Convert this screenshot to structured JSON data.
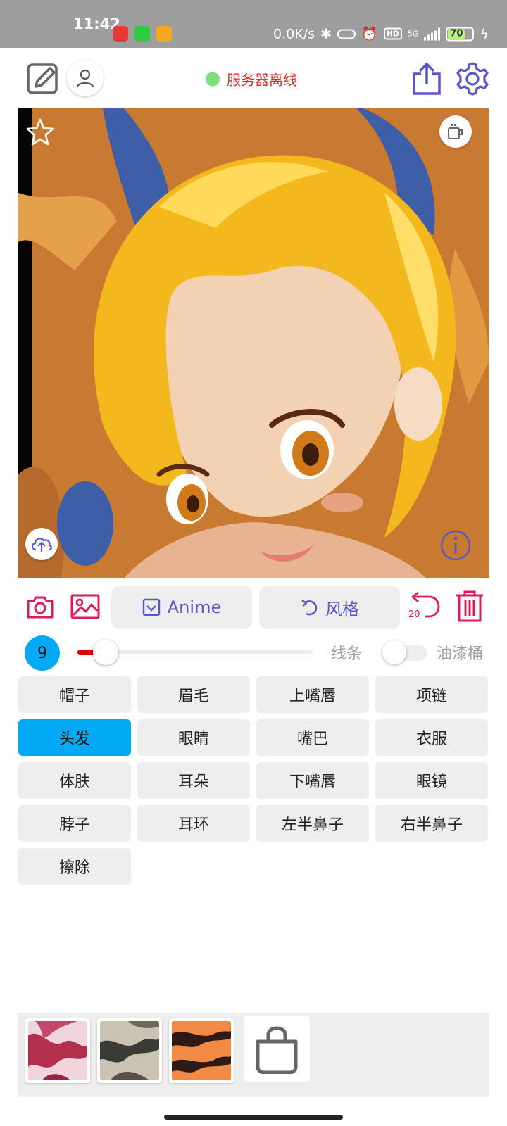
{
  "status_bar": {
    "time": "11:42",
    "net_speed": "0.0K/s",
    "network": "5G",
    "hd": "HD",
    "battery": "70"
  },
  "header": {
    "server_status": "服务器离线",
    "status_color": "#7be07b"
  },
  "toolbar": {
    "anime_label": "Anime",
    "style_label": "风格",
    "undo_count": "20"
  },
  "brush": {
    "size": "9",
    "slider_fraction": 0.12,
    "line_label": "线条",
    "bucket_label": "油漆桶"
  },
  "parts": [
    {
      "label": "帽子"
    },
    {
      "label": "眉毛"
    },
    {
      "label": "上嘴唇"
    },
    {
      "label": "项链"
    },
    {
      "label": "头发"
    },
    {
      "label": "眼睛"
    },
    {
      "label": "嘴巴"
    },
    {
      "label": "衣服"
    },
    {
      "label": "体肤"
    },
    {
      "label": "耳朵"
    },
    {
      "label": "下嘴唇"
    },
    {
      "label": "眼镜"
    },
    {
      "label": "脖子"
    },
    {
      "label": "耳环"
    },
    {
      "label": "左半鼻子"
    },
    {
      "label": "右半鼻子"
    },
    {
      "label": "擦除"
    }
  ],
  "selected_part": "头发",
  "colors": {
    "accent_blue": "#03a9f4",
    "accent_red": "#e0185c",
    "accent_purple": "#5a55c8",
    "status_text": "#c0392b"
  }
}
